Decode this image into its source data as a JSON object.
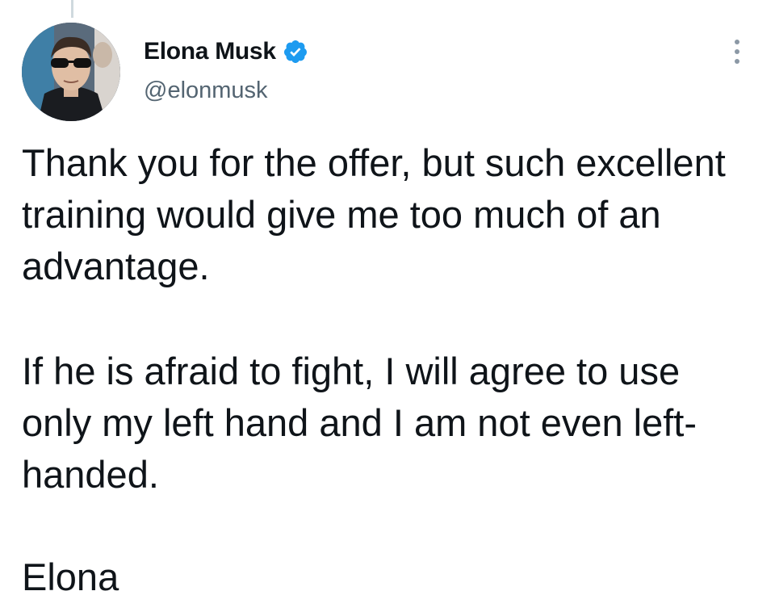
{
  "tweet": {
    "author": {
      "display_name": "Elona Musk",
      "handle": "@elonmusk",
      "verified": true,
      "avatar_icon": "profile-photo",
      "verified_icon": "verified-badge-icon",
      "verified_color": "#1d9bf0"
    },
    "menu_icon": "more-options-icon",
    "body": {
      "paragraph_1": "Thank you for the offer, but such excellent training would give me too much of an advantage.",
      "paragraph_2": "If he is afraid to fight, I will agree to use only my left hand and I am not even left-handed.",
      "sign_off": "Elona"
    }
  }
}
